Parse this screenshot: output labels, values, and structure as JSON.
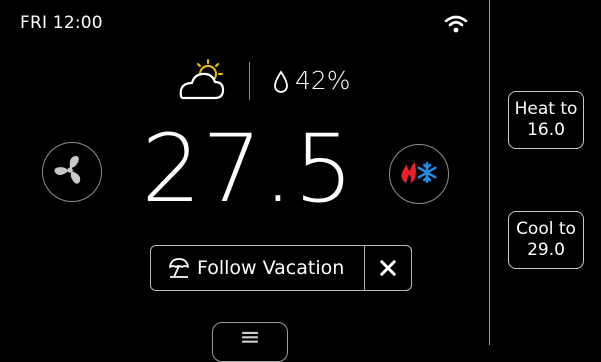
{
  "status": {
    "day_time": "FRI  12:00",
    "wifi_icon": "wifi-icon"
  },
  "weather": {
    "icon": "partly-cloudy-icon",
    "humidity": "42%",
    "humidity_icon": "water-drop-icon"
  },
  "thermostat": {
    "temperature": "27.5",
    "fan_icon": "fan-icon",
    "mode_icon": "heat-cool-icon"
  },
  "vacation": {
    "label": "Follow  Vacation",
    "icon": "beach-umbrella-icon",
    "close_icon": "close-icon"
  },
  "menu": {
    "icon": "menu-icon"
  },
  "setpoints": {
    "heat": {
      "line1": "Heat to",
      "line2": "16.0"
    },
    "cool": {
      "line1": "Cool to",
      "line2": "29.0"
    }
  },
  "colors": {
    "background": "#000000",
    "heat": "#e8202a",
    "cool": "#1e8fe8",
    "text": "#ffffff"
  }
}
